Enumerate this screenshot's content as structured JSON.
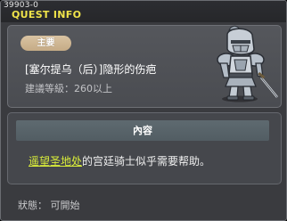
{
  "window": {
    "quest_id": "39903-0",
    "title": "QUEST INFO",
    "close_label": "×"
  },
  "quest": {
    "category": "主要",
    "name": "[塞尔提乌（后）]隐形的伤疤",
    "level_requirement": "建議等級：260以上"
  },
  "content": {
    "header": "內容",
    "link_text": "遥望圣地处",
    "text": "的宫廷骑士似乎需要帮助。"
  },
  "status": {
    "text": "狀態： 可開始"
  },
  "colors": {
    "title": "#f0e44a",
    "link": "#d8ec3a",
    "category_tag": "#d2b993"
  },
  "icons": {
    "npc": "armored-knight-portrait"
  }
}
